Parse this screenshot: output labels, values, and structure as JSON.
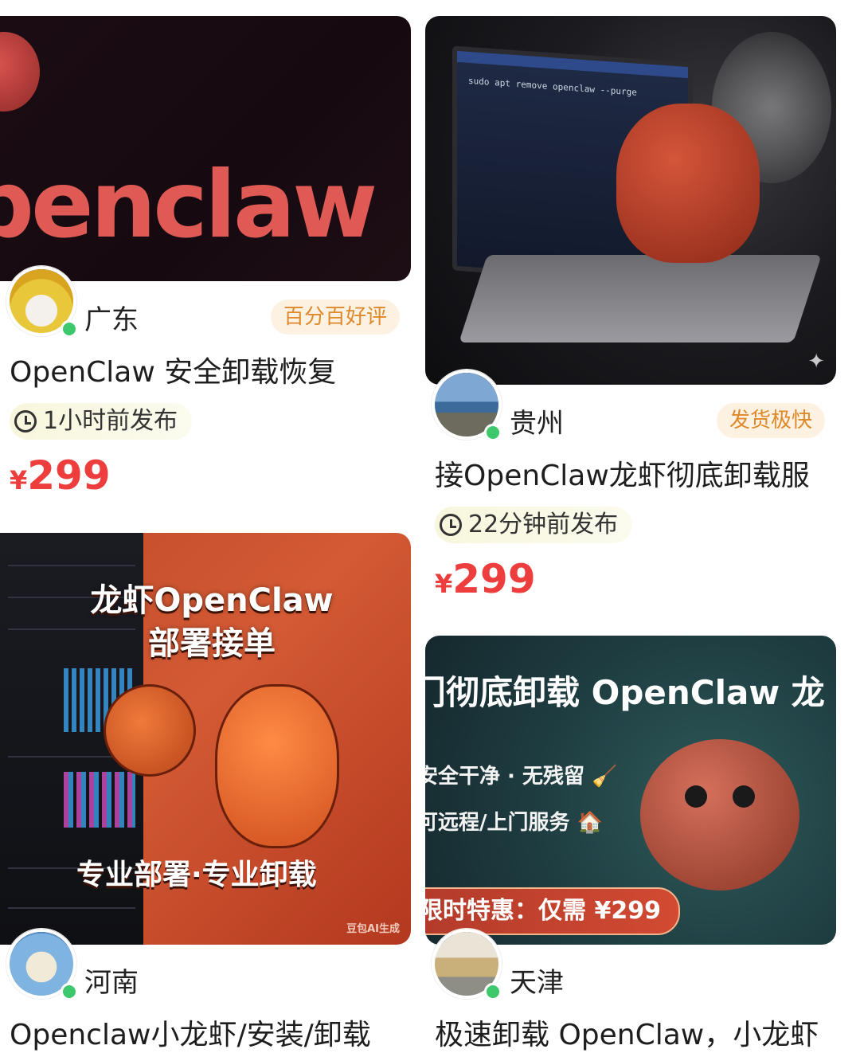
{
  "cards": [
    {
      "image": {
        "wordmark": "penclaw"
      },
      "location": "广东",
      "badge": "百分百好评",
      "title": "OpenClaw 安全卸载恢复",
      "time": "1小时前发布",
      "price_currency": "¥",
      "price_value": "299"
    },
    {
      "image": {
        "command": "sudo apt remove openclaw --purge",
        "icon": "sparkle-icon"
      },
      "location": "贵州",
      "badge": "发货极快",
      "title": "接OpenClaw龙虾彻底卸载服",
      "time": "22分钟前发布",
      "price_currency": "¥",
      "price_value": "299"
    },
    {
      "image": {
        "headline_1": "龙虾OpenClaw",
        "headline_2": "部署接单",
        "tagline": "专业部署·专业卸载",
        "watermark": "豆包AI生成"
      },
      "location": "河南",
      "title": "Openclaw小龙虾/安装/卸载"
    },
    {
      "image": {
        "headline": "门彻底卸载 OpenClaw 龙",
        "line_1": "安全干净 · 无残留 🧹",
        "line_2": "可远程/上门服务 🏠",
        "promo": "限时特惠：仅需 ¥299"
      },
      "location": "天津",
      "title": "极速卸载 OpenClaw，小龙虾"
    }
  ],
  "colors": {
    "price": "#ee3d3d",
    "badge_text": "#e0892a",
    "badge_bg": "#fdf1e2",
    "online": "#3cc86b"
  }
}
